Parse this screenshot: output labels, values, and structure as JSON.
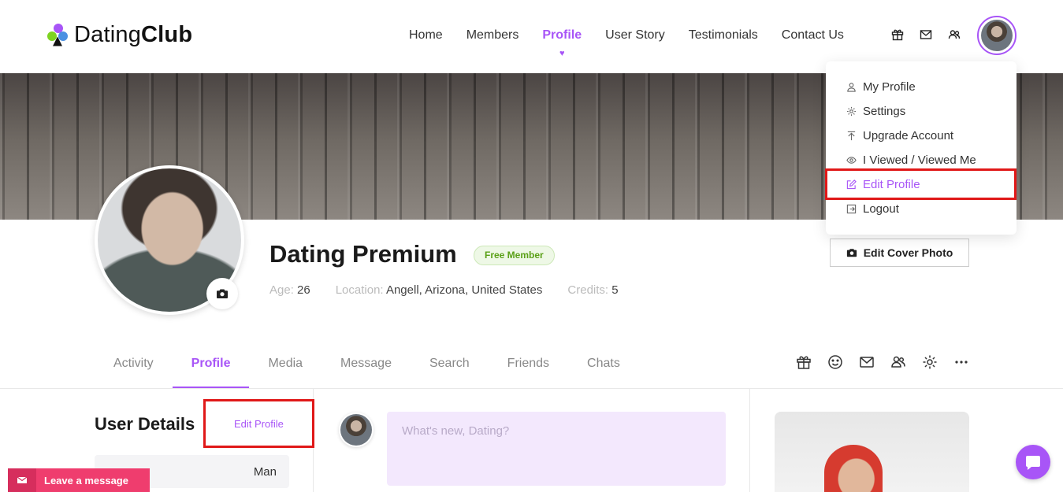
{
  "header": {
    "logo": {
      "light": "Dating",
      "bold": "Club"
    },
    "nav": [
      {
        "label": "Home"
      },
      {
        "label": "Members"
      },
      {
        "label": "Profile",
        "active": true
      },
      {
        "label": "User Story"
      },
      {
        "label": "Testimonials"
      },
      {
        "label": "Contact Us"
      }
    ],
    "icons": [
      "gift-icon",
      "mail-icon",
      "friends-icon"
    ],
    "accent_color": "#a855f7"
  },
  "dropdown": {
    "items": [
      {
        "label": "My Profile",
        "icon": "user-icon"
      },
      {
        "label": "Settings",
        "icon": "gear-icon"
      },
      {
        "label": "Upgrade Account",
        "icon": "upload-icon"
      },
      {
        "label": "I Viewed / Viewed Me",
        "icon": "eye-icon"
      },
      {
        "label": "Edit Profile",
        "icon": "edit-icon",
        "highlighted": true
      },
      {
        "label": "Logout",
        "icon": "logout-icon"
      }
    ]
  },
  "profile": {
    "name": "Dating Premium",
    "badge": "Free Member",
    "age_label": "Age:",
    "age": "26",
    "location_label": "Location:",
    "location": "Angell, Arizona, United States",
    "credits_label": "Credits:",
    "credits": "5",
    "edit_cover_label": "Edit Cover Photo"
  },
  "tabs": [
    {
      "label": "Activity"
    },
    {
      "label": "Profile",
      "active": true
    },
    {
      "label": "Media"
    },
    {
      "label": "Message"
    },
    {
      "label": "Search"
    },
    {
      "label": "Friends"
    },
    {
      "label": "Chats"
    }
  ],
  "tab_icons": [
    "gift-icon",
    "smile-icon",
    "mail-icon",
    "friends-icon",
    "gear-icon",
    "more-icon"
  ],
  "user_details": {
    "title": "User Details",
    "edit_label": "Edit Profile",
    "gender_value": "Man"
  },
  "post": {
    "placeholder": "What's new, Dating?"
  },
  "widgets": {
    "leave_message": "Leave a message"
  }
}
